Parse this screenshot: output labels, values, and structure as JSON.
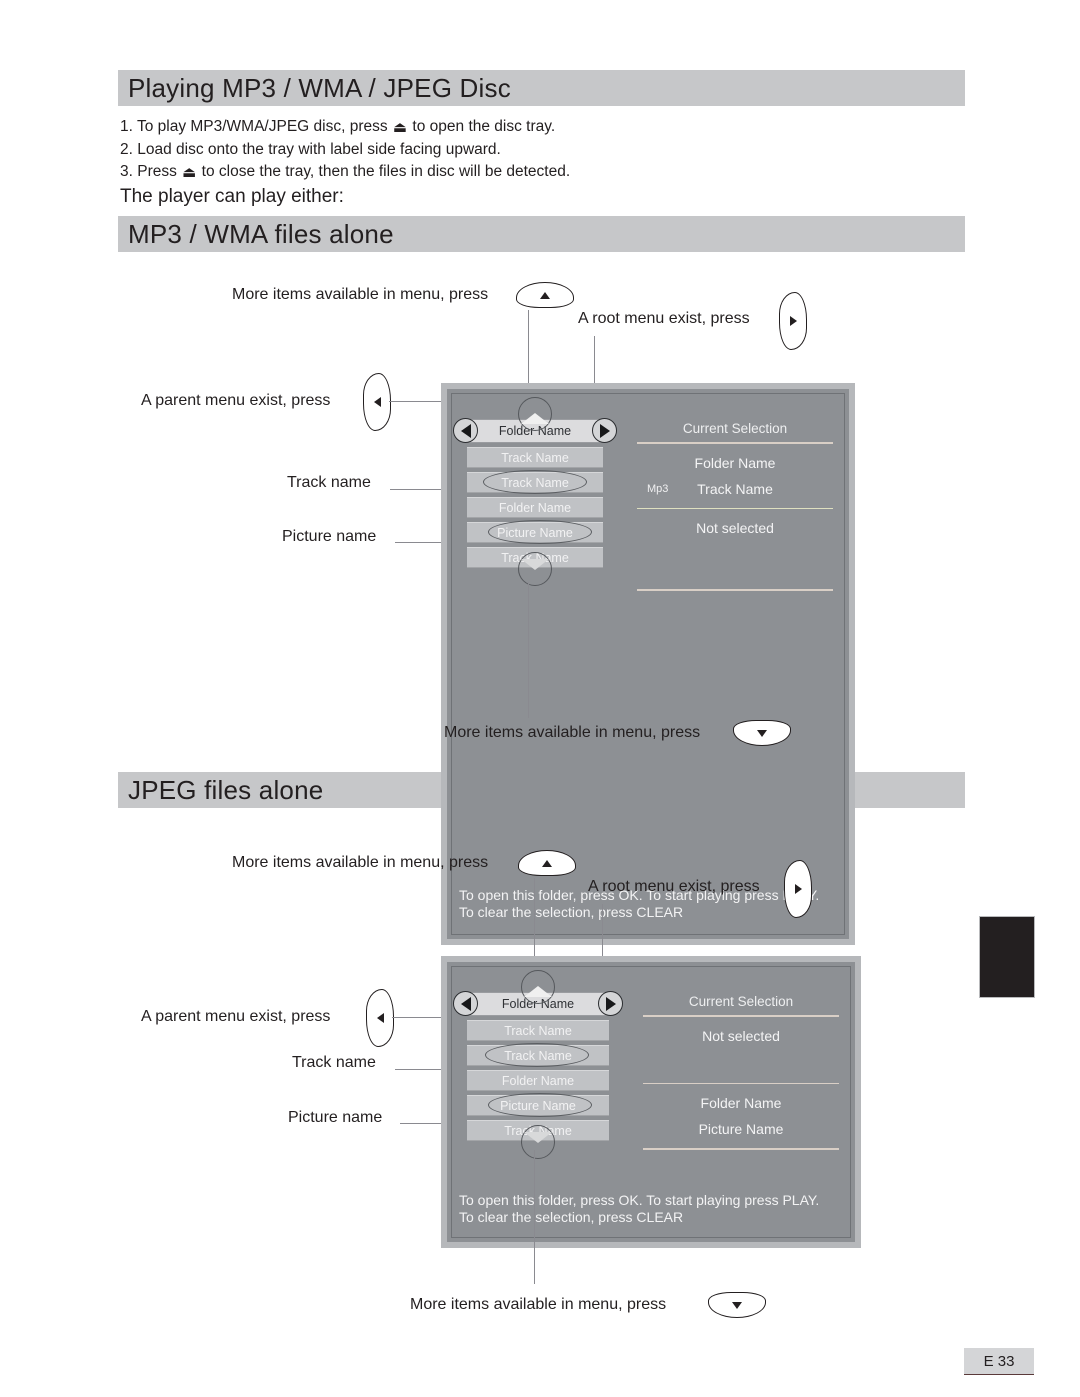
{
  "page": {
    "title": "Playing MP3 / WMA / JPEG Disc",
    "footer_label": "E 33"
  },
  "steps": {
    "step1_pre": "1. To play MP3/WMA/JPEG disc, press",
    "eject_icon": "⏏",
    "step1_post": "to open the disc tray.",
    "step2": "2. Load disc onto the tray with label side facing upward.",
    "step3_pre": "3. Press",
    "step3_post": "to close the tray, then the files in disc will be detected.",
    "subhead": "The player can play either:"
  },
  "sections": [
    {
      "id": "mp3",
      "band_title": "MP3 / WMA files alone"
    },
    {
      "id": "jpeg",
      "band_title": "JPEG files alone"
    }
  ],
  "callouts": {
    "more_items_top": "More items available in menu, press",
    "more_items_bottom": "More items available in menu, press",
    "root_menu": "A root menu exist, press",
    "parent_menu": "A parent menu exist, press",
    "track_name": "Track name",
    "picture_name": "Picture name"
  },
  "keys": {
    "up": "up-arrow-key",
    "down": "down-arrow-key",
    "left": "left-arrow-key",
    "right": "right-arrow-key"
  },
  "screen_mp3": {
    "header_row": "Folder Name",
    "rows": [
      "Track Name",
      "Track Name",
      "Folder Name",
      "Picture Name",
      "Track Name"
    ],
    "selection_title": "Current Selection",
    "selection_block1_line1": "Folder Name",
    "selection_block1_line2": "Track Name",
    "selection_block1_badge": "Mp3",
    "selection_block2_line1": "Not selected",
    "help_line1": "To open this folder, press OK. To start playing press PLAY.",
    "help_line2": "To clear the selection, press CLEAR"
  },
  "screen_jpeg": {
    "header_row": "Folder Name",
    "rows": [
      "Track Name",
      "Track Name",
      "Folder Name",
      "Picture Name",
      "Track Name"
    ],
    "selection_title": "Current Selection",
    "selection_block1_line1": "Not selected",
    "selection_block2_line1": "Folder Name",
    "selection_block2_line2": "Picture Name",
    "help_line1": "To open this folder, press OK. To start playing press PLAY.",
    "help_line2": "To clear the selection, press CLEAR"
  },
  "colors": {
    "band": "#c6c7c9",
    "screen_bg": "#8d9094",
    "screen_border": "#b6b8bb",
    "row_item": "#c0c2c5",
    "row_header": "#dcdcde",
    "text": "#231f20"
  }
}
